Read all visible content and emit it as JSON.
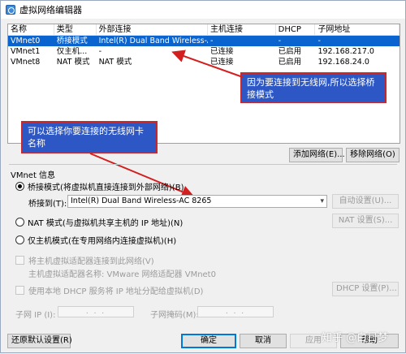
{
  "window": {
    "title": "虚拟网络编辑器"
  },
  "table": {
    "columns": [
      "名称",
      "类型",
      "外部连接",
      "主机连接",
      "DHCP",
      "子网地址"
    ],
    "rows": [
      [
        "VMnet0",
        "桥接模式",
        "Intel(R) Dual Band Wireless-A...",
        "-",
        "-",
        "-"
      ],
      [
        "VMnet1",
        "仅主机...",
        "-",
        "已连接",
        "已启用",
        "192.168.217.0"
      ],
      [
        "VMnet8",
        "NAT 模式",
        "NAT 模式",
        "已连接",
        "已启用",
        "192.168.24.0"
      ]
    ],
    "selected_index": 0
  },
  "callouts": {
    "bridge_note": "因为要连接到无线网,所以选择桥接模式",
    "adapter_note": "可以选择你要连接的无线网卡名称"
  },
  "buttons": {
    "add_network": "添加网络(E)...",
    "remove_network": "移除网络(O)",
    "auto_settings": "自动设置(U)...",
    "nat_settings": "NAT 设置(S)...",
    "dhcp_settings": "DHCP 设置(P)...",
    "restore_defaults": "还原默认设置(R)",
    "ok": "确定",
    "cancel": "取消",
    "apply": "应用",
    "help": "帮助"
  },
  "vmnet_info": {
    "title": "VMnet 信息",
    "bridged_label": "桥接模式(将虚拟机直接连接到外部网络)(B)",
    "bridged_to_label": "桥接到(T):",
    "bridged_to_value": "Intel(R) Dual Band Wireless-AC 8265",
    "nat_label": "NAT 模式(与虚拟机共享主机的 IP 地址)(N)",
    "host_only_label": "仅主机模式(在专用网络内连接虚拟机)(H)",
    "connect_host_adapter": "将主机虚拟适配器连接到此网络(V)",
    "host_adapter_name": "主机虚拟适配器名称: VMware 网络适配器 VMnet0",
    "use_local_dhcp": "使用本地 DHCP 服务将 IP 地址分配给虚拟机(D)",
    "subnet_ip_label": "子网 IP (I):",
    "subnet_mask_label": "子网掩码(M):",
    "ip_placeholder": ". . ."
  },
  "watermark": "知乎 @白日梦"
}
